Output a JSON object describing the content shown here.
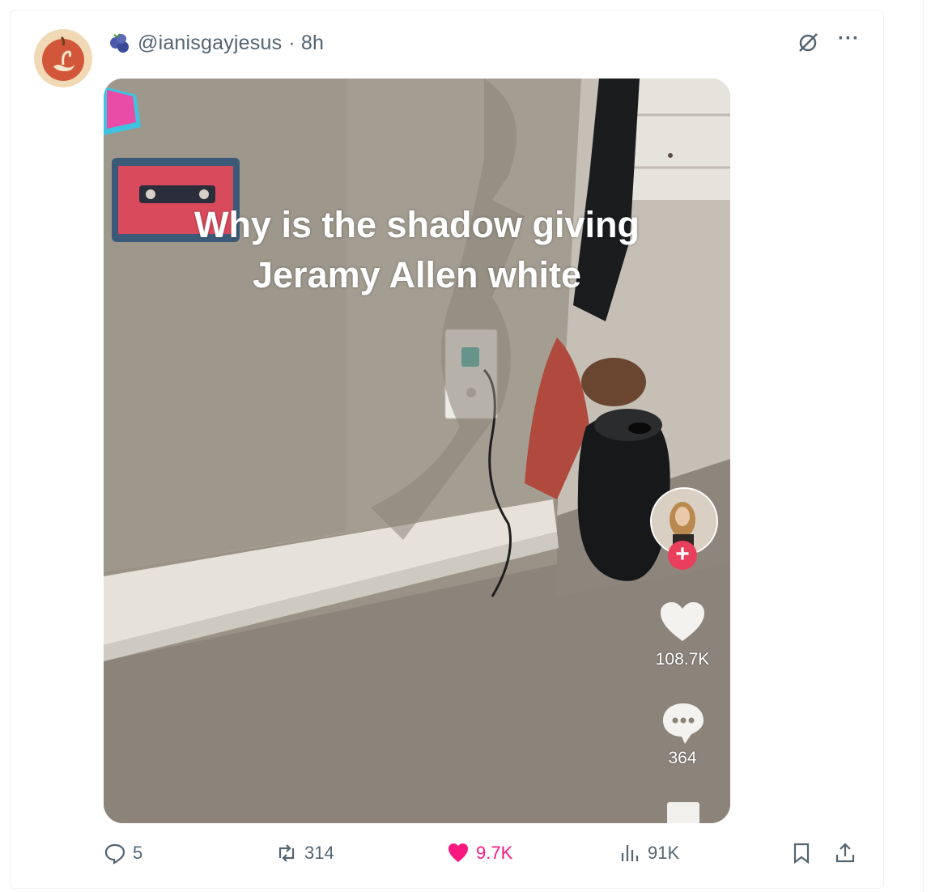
{
  "tweet": {
    "handle": "@ianisgayjesus",
    "time": "· 8h",
    "handle_badge_icon": "blueberry-icon",
    "avatar_icon": "swan-apple-icon"
  },
  "media": {
    "caption_line1": "Why is the shadow giving",
    "caption_line2": "Jeramy Allen white",
    "like_count": "108.7K",
    "comment_count": "364"
  },
  "actions": {
    "replies": "5",
    "retweets": "314",
    "likes": "9.7K",
    "views": "91K"
  },
  "colors": {
    "like_pink": "#f91880",
    "muted": "#536471",
    "tiktok_red": "#ea3f5c"
  }
}
